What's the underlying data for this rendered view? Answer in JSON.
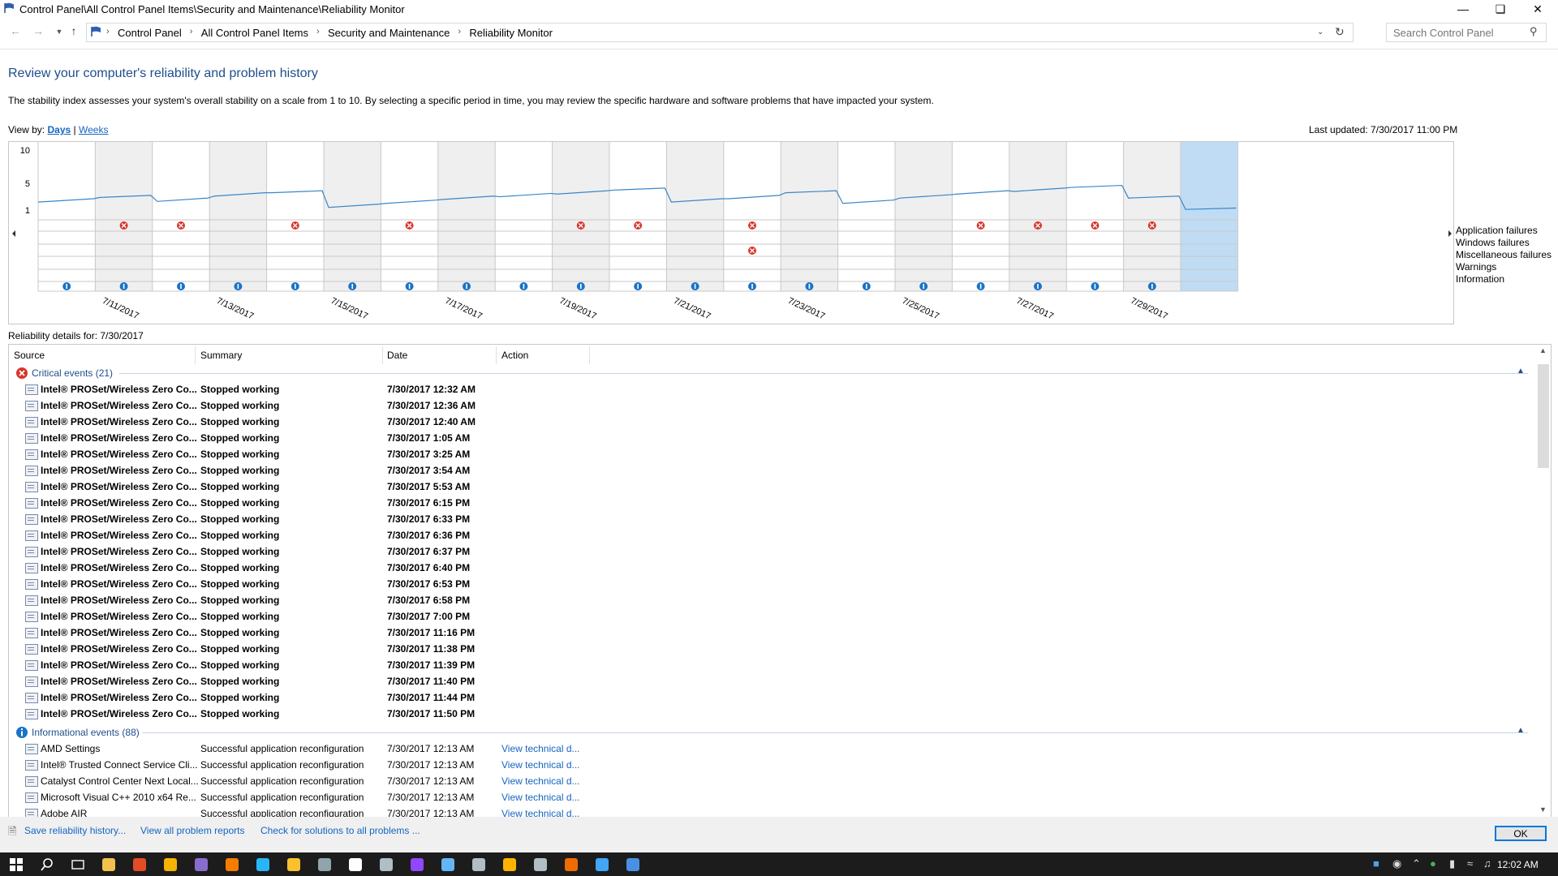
{
  "window": {
    "title": "Control Panel\\All Control Panel Items\\Security and Maintenance\\Reliability Monitor",
    "minimize_icon": "minimize-icon",
    "maximize_icon": "restore-icon",
    "close_icon": "close-icon"
  },
  "address": {
    "crumbs": [
      "Control Panel",
      "All Control Panel Items",
      "Security and Maintenance",
      "Reliability Monitor"
    ],
    "search_placeholder": "Search Control Panel"
  },
  "header": {
    "title": "Review your computer's reliability and problem history",
    "description": "The stability index assesses your system's overall stability on a scale from 1 to 10. By selecting a specific period in time, you may review the specific hardware and software problems that have impacted your system.",
    "view_by_label": "View by:",
    "view_days": "Days",
    "view_separator": "|",
    "view_weeks": "Weeks",
    "last_updated": "Last updated: 7/30/2017 11:00 PM"
  },
  "chart_data": {
    "type": "line",
    "y_ticks": [
      "10",
      "5",
      "1"
    ],
    "ylim": [
      1,
      10
    ],
    "x_labels": [
      "7/11/2017",
      "7/13/2017",
      "7/15/2017",
      "7/17/2017",
      "7/19/2017",
      "7/21/2017",
      "7/23/2017",
      "7/25/2017",
      "7/27/2017",
      "7/29/2017"
    ],
    "days": [
      "7/10",
      "7/11",
      "7/12",
      "7/13",
      "7/14",
      "7/15",
      "7/16",
      "7/17",
      "7/18",
      "7/19",
      "7/20",
      "7/21",
      "7/22",
      "7/23",
      "7/24",
      "7/25",
      "7/26",
      "7/27",
      "7/28",
      "7/29",
      "7/30"
    ],
    "selected_day": "7/30",
    "stability_index": [
      2.2,
      2.9,
      2.3,
      3.1,
      3.6,
      1.4,
      2.0,
      2.6,
      3.0,
      3.4,
      4.0,
      2.2,
      2.7,
      3.6,
      2.0,
      2.8,
      3.4,
      3.8,
      4.4,
      2.8,
      1.1
    ],
    "legend": [
      "Application failures",
      "Windows failures",
      "Miscellaneous failures",
      "Warnings",
      "Information"
    ],
    "application_failures": [
      "7/11",
      "7/12",
      "7/14",
      "7/16",
      "7/19",
      "7/20",
      "7/22",
      "7/26",
      "7/27",
      "7/28",
      "7/29"
    ],
    "misc_failures": [
      "7/22"
    ],
    "information": [
      "7/10",
      "7/11",
      "7/12",
      "7/13",
      "7/14",
      "7/15",
      "7/16",
      "7/17",
      "7/18",
      "7/19",
      "7/20",
      "7/21",
      "7/22",
      "7/23",
      "7/24",
      "7/25",
      "7/26",
      "7/27",
      "7/28",
      "7/29"
    ],
    "scroll_left_icon": "triangle-left-icon",
    "scroll_right_icon": "triangle-right-icon"
  },
  "details": {
    "label": "Reliability details for: 7/30/2017",
    "columns": [
      "Source",
      "Summary",
      "Date",
      "Action"
    ],
    "sort_icon": "sort-ascending-icon",
    "critical": {
      "header": "Critical events (21)",
      "rows": [
        {
          "source": "Intel® PROSet/Wireless Zero Co...",
          "summary": "Stopped working",
          "date": "7/30/2017 12:32 AM"
        },
        {
          "source": "Intel® PROSet/Wireless Zero Co...",
          "summary": "Stopped working",
          "date": "7/30/2017 12:36 AM"
        },
        {
          "source": "Intel® PROSet/Wireless Zero Co...",
          "summary": "Stopped working",
          "date": "7/30/2017 12:40 AM"
        },
        {
          "source": "Intel® PROSet/Wireless Zero Co...",
          "summary": "Stopped working",
          "date": "7/30/2017 1:05 AM"
        },
        {
          "source": "Intel® PROSet/Wireless Zero Co...",
          "summary": "Stopped working",
          "date": "7/30/2017 3:25 AM"
        },
        {
          "source": "Intel® PROSet/Wireless Zero Co...",
          "summary": "Stopped working",
          "date": "7/30/2017 3:54 AM"
        },
        {
          "source": "Intel® PROSet/Wireless Zero Co...",
          "summary": "Stopped working",
          "date": "7/30/2017 5:53 AM"
        },
        {
          "source": "Intel® PROSet/Wireless Zero Co...",
          "summary": "Stopped working",
          "date": "7/30/2017 6:15 PM"
        },
        {
          "source": "Intel® PROSet/Wireless Zero Co...",
          "summary": "Stopped working",
          "date": "7/30/2017 6:33 PM"
        },
        {
          "source": "Intel® PROSet/Wireless Zero Co...",
          "summary": "Stopped working",
          "date": "7/30/2017 6:36 PM"
        },
        {
          "source": "Intel® PROSet/Wireless Zero Co...",
          "summary": "Stopped working",
          "date": "7/30/2017 6:37 PM"
        },
        {
          "source": "Intel® PROSet/Wireless Zero Co...",
          "summary": "Stopped working",
          "date": "7/30/2017 6:40 PM"
        },
        {
          "source": "Intel® PROSet/Wireless Zero Co...",
          "summary": "Stopped working",
          "date": "7/30/2017 6:53 PM"
        },
        {
          "source": "Intel® PROSet/Wireless Zero Co...",
          "summary": "Stopped working",
          "date": "7/30/2017 6:58 PM"
        },
        {
          "source": "Intel® PROSet/Wireless Zero Co...",
          "summary": "Stopped working",
          "date": "7/30/2017 7:00 PM"
        },
        {
          "source": "Intel® PROSet/Wireless Zero Co...",
          "summary": "Stopped working",
          "date": "7/30/2017 11:16 PM"
        },
        {
          "source": "Intel® PROSet/Wireless Zero Co...",
          "summary": "Stopped working",
          "date": "7/30/2017 11:38 PM"
        },
        {
          "source": "Intel® PROSet/Wireless Zero Co...",
          "summary": "Stopped working",
          "date": "7/30/2017 11:39 PM"
        },
        {
          "source": "Intel® PROSet/Wireless Zero Co...",
          "summary": "Stopped working",
          "date": "7/30/2017 11:40 PM"
        },
        {
          "source": "Intel® PROSet/Wireless Zero Co...",
          "summary": "Stopped working",
          "date": "7/30/2017 11:44 PM"
        },
        {
          "source": "Intel® PROSet/Wireless Zero Co...",
          "summary": "Stopped working",
          "date": "7/30/2017 11:50 PM"
        }
      ]
    },
    "informational": {
      "header": "Informational events (88)",
      "rows": [
        {
          "source": "AMD Settings",
          "summary": "Successful application reconfiguration",
          "date": "7/30/2017 12:13 AM",
          "action": "View  technical d..."
        },
        {
          "source": "Intel® Trusted Connect Service Cli...",
          "summary": "Successful application reconfiguration",
          "date": "7/30/2017 12:13 AM",
          "action": "View  technical d..."
        },
        {
          "source": "Catalyst Control Center Next Local...",
          "summary": "Successful application reconfiguration",
          "date": "7/30/2017 12:13 AM",
          "action": "View  technical d..."
        },
        {
          "source": "Microsoft Visual C++ 2010  x64 Re...",
          "summary": "Successful application reconfiguration",
          "date": "7/30/2017 12:13 AM",
          "action": "View  technical d..."
        },
        {
          "source": "Adobe AIR",
          "summary": "Successful application reconfiguration",
          "date": "7/30/2017 12:13 AM",
          "action": "View  technical d..."
        }
      ]
    }
  },
  "footer": {
    "save_history": "Save reliability history...",
    "view_all": "View all problem reports",
    "check_solutions": "Check for solutions to all problems ...",
    "ok": "OK"
  },
  "taskbar": {
    "clock": "12:02 AM",
    "icons": [
      "windows-start-icon",
      "search-icon",
      "task-view-icon",
      "file-explorer-icon",
      "chrome-icon",
      "chrome-canary-icon",
      "app-icon",
      "vlc-icon",
      "app-icon",
      "app-icon",
      "app-icon",
      "app-icon",
      "app-icon",
      "twitch-icon",
      "app-icon",
      "steam-icon",
      "app-icon",
      "app-icon",
      "app-icon",
      "app-icon",
      "control-panel-icon"
    ]
  },
  "colors": {
    "heading": "#1e4e8c",
    "link": "#1565c0",
    "line": "#3a86c8",
    "error": "#d9352b",
    "info": "#1a73c7",
    "selected": "#bfdcf4"
  }
}
